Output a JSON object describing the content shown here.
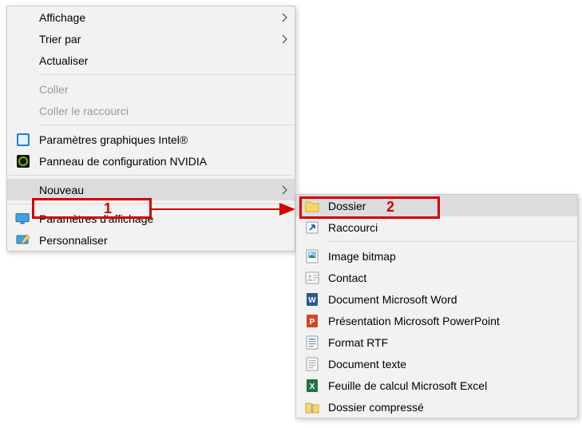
{
  "callouts": {
    "num1": "1",
    "num2": "2"
  },
  "main_menu": {
    "items": [
      {
        "label": "Affichage",
        "icon": null,
        "arrow": true,
        "disabled": false
      },
      {
        "label": "Trier par",
        "icon": null,
        "arrow": true,
        "disabled": false
      },
      {
        "label": "Actualiser",
        "icon": null,
        "arrow": false,
        "disabled": false
      },
      {
        "sep": true
      },
      {
        "label": "Coller",
        "icon": null,
        "arrow": false,
        "disabled": true
      },
      {
        "label": "Coller le raccourci",
        "icon": null,
        "arrow": false,
        "disabled": true
      },
      {
        "sep": true
      },
      {
        "label": "Paramètres graphiques Intel®",
        "icon": "intel-icon",
        "arrow": false,
        "disabled": false
      },
      {
        "label": "Panneau de configuration NVIDIA",
        "icon": "nvidia-icon",
        "arrow": false,
        "disabled": false
      },
      {
        "sep": true,
        "full": true
      },
      {
        "label": "Nouveau",
        "icon": null,
        "arrow": true,
        "disabled": false,
        "hover": true
      },
      {
        "sep": true,
        "full": true
      },
      {
        "label": "Paramètres d'affichage",
        "icon": "display-icon",
        "arrow": false,
        "disabled": false
      },
      {
        "label": "Personnaliser",
        "icon": "personalize-icon",
        "arrow": false,
        "disabled": false
      }
    ]
  },
  "sub_menu": {
    "items": [
      {
        "label": "Dossier",
        "icon": "folder-icon",
        "hover": true
      },
      {
        "label": "Raccourci",
        "icon": "shortcut-icon"
      },
      {
        "sep": true
      },
      {
        "label": "Image bitmap",
        "icon": "bitmap-icon"
      },
      {
        "label": "Contact",
        "icon": "contact-icon"
      },
      {
        "label": "Document Microsoft Word",
        "icon": "word-icon"
      },
      {
        "label": "Présentation Microsoft PowerPoint",
        "icon": "ppt-icon"
      },
      {
        "label": "Format RTF",
        "icon": "rtf-icon"
      },
      {
        "label": "Document texte",
        "icon": "txt-icon"
      },
      {
        "label": "Feuille de calcul Microsoft Excel",
        "icon": "excel-icon"
      },
      {
        "label": "Dossier compressé",
        "icon": "zip-icon"
      }
    ]
  }
}
